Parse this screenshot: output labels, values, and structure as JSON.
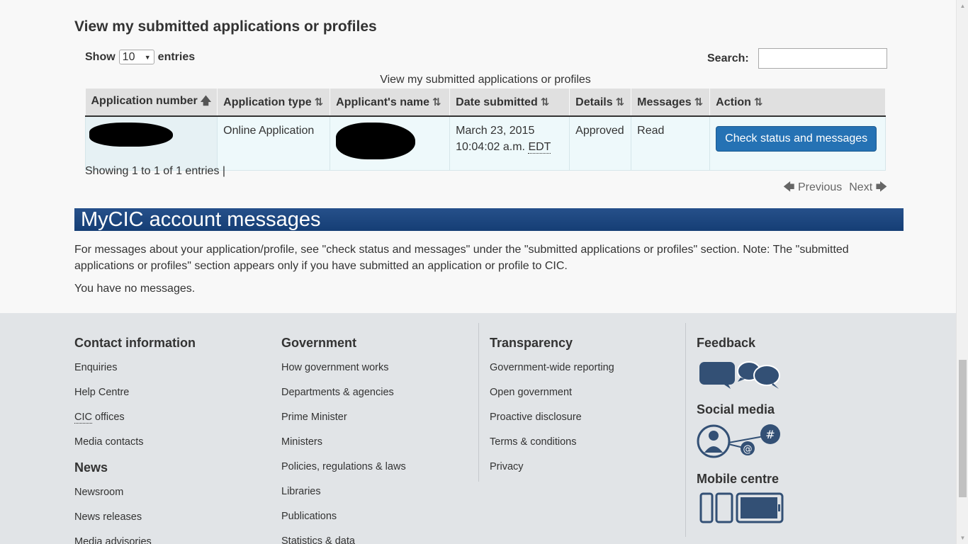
{
  "section": {
    "title": "View my submitted applications or profiles",
    "show_label": "Show",
    "show_value": "10",
    "entries_label": "entries",
    "search_label": "Search:",
    "caption": "View my submitted applications or profiles"
  },
  "table": {
    "headers": [
      "Application number",
      "Application type",
      "Applicant's name",
      "Date submitted",
      "Details",
      "Messages",
      "Action"
    ],
    "rows": [
      {
        "application_type": "Online Application",
        "date_line1": "March 23, 2015",
        "date_line2": "10:04:02 a.m.",
        "date_tz": "EDT",
        "details": "Approved",
        "messages": "Read",
        "action": "Check status and messages"
      }
    ]
  },
  "showing": "Showing 1 to 1 of 1 entries",
  "pager": {
    "previous": "Previous",
    "next": "Next"
  },
  "messages": {
    "title": "MyCIC account messages",
    "text": "For messages about your application/profile, see \"check status and messages\" under the \"submitted applications or profiles\" section. Note: The \"submitted applications or profiles\" section appears only if you have submitted an application or profile to CIC.",
    "none": "You have no messages."
  },
  "footer": {
    "contact": {
      "title": "Contact information",
      "items": [
        "Enquiries",
        "Help Centre",
        "CIC",
        "offices",
        "Media contacts"
      ]
    },
    "news": {
      "title": "News",
      "items": [
        "Newsroom",
        "News releases",
        "Media advisories"
      ]
    },
    "government": {
      "title": "Government",
      "items": [
        "How government works",
        "Departments & agencies",
        "Prime Minister",
        "Ministers",
        "Policies, regulations & laws",
        "Libraries",
        "Publications",
        "Statistics & data"
      ]
    },
    "transparency": {
      "title": "Transparency",
      "items": [
        "Government-wide reporting",
        "Open government",
        "Proactive disclosure",
        "Terms & conditions",
        "Privacy"
      ]
    },
    "feedback": {
      "title": "Feedback"
    },
    "social": {
      "title": "Social media"
    },
    "mobile": {
      "title": "Mobile centre"
    }
  },
  "colors": {
    "banner": "#1f4a82",
    "button": "#2572b4",
    "footer_bg": "#e1e4e7"
  }
}
